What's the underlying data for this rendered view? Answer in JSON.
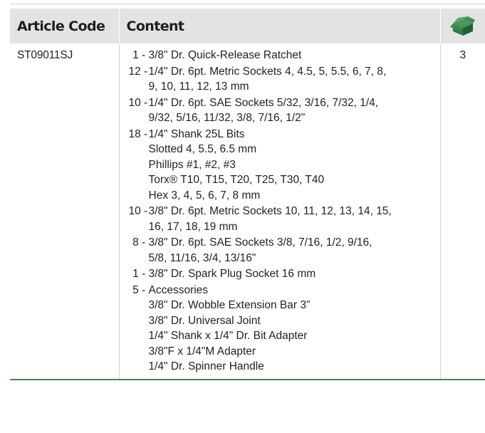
{
  "table": {
    "headers": {
      "article_code": "Article Code",
      "content": "Content",
      "quantity_icon": "box-icon"
    },
    "row": {
      "article_code": "ST09011SJ",
      "quantity": "3",
      "items": [
        {
          "count": "1",
          "text": "3/8\" Dr. Quick-Release Ratchet",
          "sub": []
        },
        {
          "count": "12",
          "text": "1/4\" Dr. 6pt. Metric Sockets 4, 4.5, 5, 5.5, 6, 7, 8,\n9, 10, 11, 12, 13 mm",
          "sub": []
        },
        {
          "count": "10",
          "text": "1/4\" Dr. 6pt. SAE Sockets 5/32, 3/16, 7/32, 1/4,\n9/32, 5/16, 11/32, 3/8, 7/16, 1/2\"",
          "sub": []
        },
        {
          "count": "18",
          "text": "1/4\" Shank 25L Bits",
          "sub": [
            "Slotted 4, 5.5, 6.5 mm",
            "Phillips #1, #2, #3",
            "Torx® T10, T15, T20, T25, T30, T40",
            "Hex 3, 4, 5, 6, 7, 8 mm"
          ]
        },
        {
          "count": "10",
          "text": "3/8\" Dr. 6pt. Metric Sockets 10, 11, 12, 13, 14, 15,\n16, 17, 18, 19 mm",
          "sub": []
        },
        {
          "count": "8",
          "text": "3/8\" Dr. 6pt. SAE Sockets 3/8, 7/16, 1/2, 9/16,\n5/8, 11/16, 3/4, 13/16\"",
          "sub": []
        },
        {
          "count": "1",
          "text": "3/8\" Dr. Spark Plug Socket 16 mm",
          "sub": []
        },
        {
          "count": "5",
          "text": "Accessories",
          "sub": [
            "3/8\" Dr. Wobble Extension Bar 3\"",
            "3/8\" Dr. Universal Joint",
            "1/4\" Shank x 1/4\" Dr. Bit Adapter",
            "3/8\"F x 1/4\"M Adapter",
            "1/4\" Dr. Spinner Handle"
          ]
        }
      ]
    }
  },
  "colors": {
    "header_bg": "#e3e3e3",
    "accent_green": "#3a8a4e"
  }
}
